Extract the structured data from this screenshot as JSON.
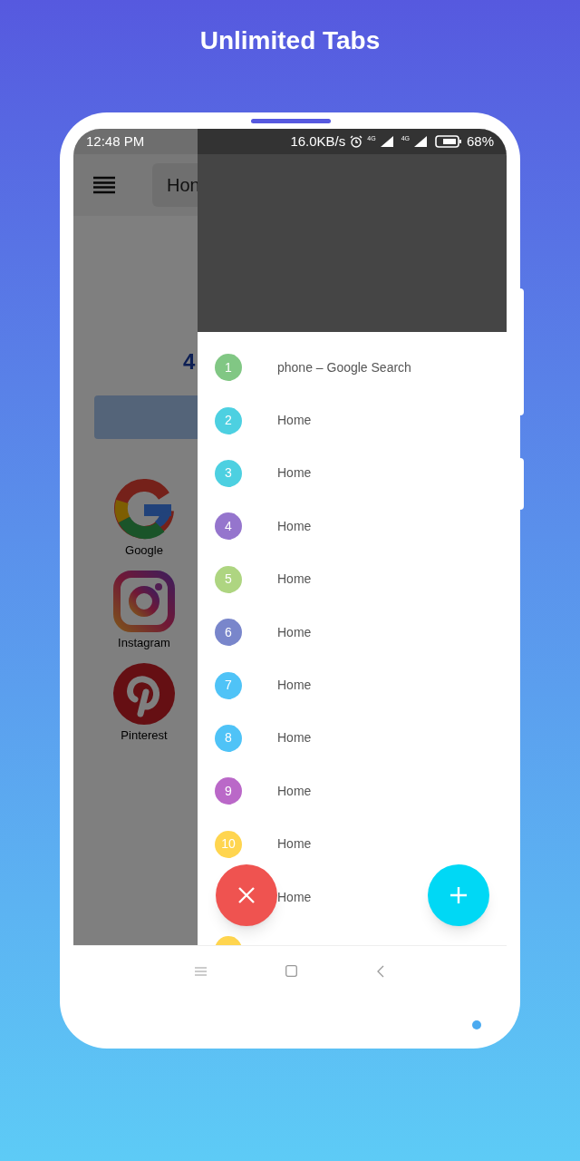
{
  "headline": "Unlimited Tabs",
  "status_bar": {
    "time": "12:48 PM",
    "speed": "16.0KB/s",
    "network_1": "4G",
    "network_2": "4G",
    "battery": "68%"
  },
  "toolbar": {
    "address": "Hon"
  },
  "page": {
    "heading": "4",
    "shortcuts": [
      {
        "kind": "google",
        "label": "Google"
      },
      {
        "kind": "instagram",
        "label": "Instagram"
      },
      {
        "kind": "pinterest",
        "label": "Pinterest"
      }
    ]
  },
  "tabs": [
    {
      "number": "1",
      "title": "phone – Google Search",
      "color": "#81c784"
    },
    {
      "number": "2",
      "title": "Home",
      "color": "#4dd0e1"
    },
    {
      "number": "3",
      "title": "Home",
      "color": "#4dd0e1"
    },
    {
      "number": "4",
      "title": "Home",
      "color": "#9575cd"
    },
    {
      "number": "5",
      "title": "Home",
      "color": "#aed581"
    },
    {
      "number": "6",
      "title": "Home",
      "color": "#7986cb"
    },
    {
      "number": "7",
      "title": "Home",
      "color": "#4fc3f7"
    },
    {
      "number": "8",
      "title": "Home",
      "color": "#4fc3f7"
    },
    {
      "number": "9",
      "title": "Home",
      "color": "#ba68c8"
    },
    {
      "number": "10",
      "title": "Home",
      "color": "#ffd54f"
    },
    {
      "title": "Home"
    },
    {
      "color": "#ffd54f"
    }
  ]
}
